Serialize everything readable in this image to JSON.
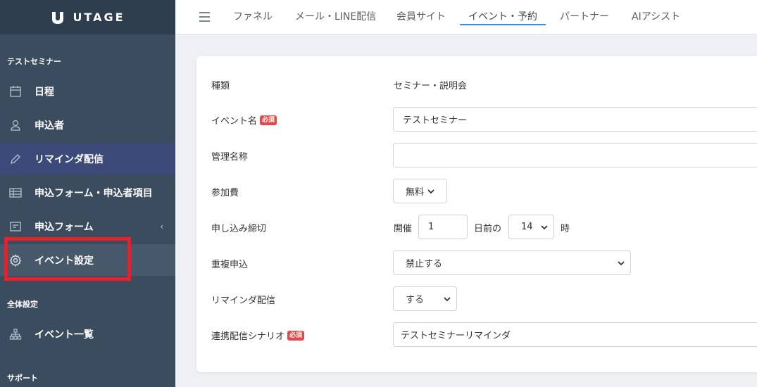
{
  "brand": {
    "name": "UTAGE"
  },
  "sidebar": {
    "section_seminar": "テストセミナー",
    "items": [
      {
        "label": "日程",
        "icon": "calendar-icon"
      },
      {
        "label": "申込者",
        "icon": "user-icon"
      },
      {
        "label": "リマインダ配信",
        "icon": "pencil-icon"
      },
      {
        "label": "申込フォーム・申込者項目",
        "icon": "table-icon"
      },
      {
        "label": "申込フォーム",
        "icon": "form-icon",
        "chevron": "‹"
      },
      {
        "label": "イベント設定",
        "icon": "gear-icon"
      }
    ],
    "section_global": "全体設定",
    "global_items": [
      {
        "label": "イベント一覧",
        "icon": "sitemap-icon"
      }
    ],
    "section_support": "サポート"
  },
  "topnav": {
    "tabs": [
      "ファネル",
      "メール・LINE配信",
      "会員サイト",
      "イベント・予約",
      "パートナー",
      "AIアシスト"
    ],
    "active_index": 3
  },
  "form": {
    "required_badge": "必須",
    "type": {
      "label": "種類",
      "value": "セミナー・説明会"
    },
    "event_name": {
      "label": "イベント名",
      "value": "テストセミナー"
    },
    "admin_name": {
      "label": "管理名称",
      "value": ""
    },
    "fee": {
      "label": "参加費",
      "value": "無料"
    },
    "deadline": {
      "label": "申し込み締切",
      "prefix": "開催",
      "days": "1",
      "middle": "日前の",
      "hour": "14",
      "suffix": "時"
    },
    "duplicate": {
      "label": "重複申込",
      "value": "禁止する"
    },
    "reminder": {
      "label": "リマインダ配信",
      "value": "する"
    },
    "scenario": {
      "label": "連携配信シナリオ",
      "value": "テストセミナーリマインダ"
    }
  },
  "colors": {
    "sidebar": "#3b4c5f",
    "highlight": "#e8202a",
    "accent": "#3a8fd6",
    "required": "#e24a4a"
  }
}
